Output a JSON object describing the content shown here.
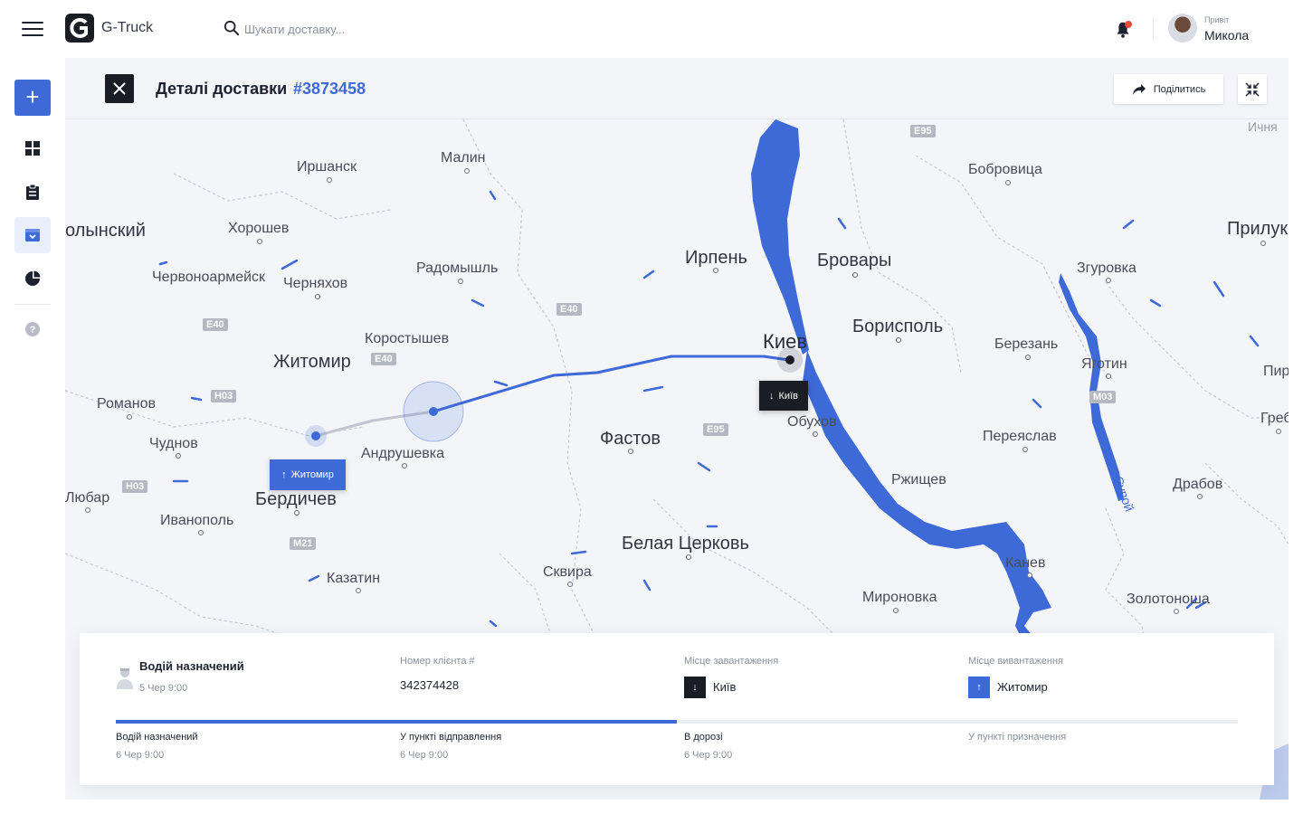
{
  "app": {
    "name": "G-Truck"
  },
  "search": {
    "placeholder": "Шукати доставку..."
  },
  "user": {
    "greeting": "Привіт",
    "name": "Микола"
  },
  "sidebar": {
    "items": [
      {
        "name": "dashboard",
        "icon": "grid-icon"
      },
      {
        "name": "clipboard",
        "icon": "clipboard-icon"
      },
      {
        "name": "deliveries",
        "icon": "box-icon",
        "active": true
      },
      {
        "name": "reports",
        "icon": "pie-chart-icon"
      },
      {
        "name": "help",
        "icon": "question-icon"
      }
    ]
  },
  "header": {
    "title": "Деталі доставки",
    "order_number": "#3873458",
    "share_label": "Поділитись"
  },
  "map": {
    "cities": [
      {
        "name": "Иршанск",
        "size": "normal"
      },
      {
        "name": "Малин",
        "size": "normal"
      },
      {
        "name": "Бобровица",
        "size": "normal"
      },
      {
        "name": "олынский",
        "size": "normal"
      },
      {
        "name": "Хорошев",
        "size": "normal"
      },
      {
        "name": "Прилук",
        "size": "normal"
      },
      {
        "name": "Радомышль",
        "size": "normal"
      },
      {
        "name": "Ирпень",
        "size": "normal"
      },
      {
        "name": "Бровары",
        "size": "big"
      },
      {
        "name": "Згуровка",
        "size": "normal"
      },
      {
        "name": "Червоноармейск",
        "size": "normal"
      },
      {
        "name": "Черняхов",
        "size": "normal"
      },
      {
        "name": "Киев",
        "size": "huge"
      },
      {
        "name": "Борисполь",
        "size": "big"
      },
      {
        "name": "Коростышев",
        "size": "normal"
      },
      {
        "name": "Житомир",
        "size": "big"
      },
      {
        "name": "Березань",
        "size": "normal"
      },
      {
        "name": "Яготин",
        "size": "normal"
      },
      {
        "name": "Пир",
        "size": "normal"
      },
      {
        "name": "Романов",
        "size": "normal"
      },
      {
        "name": "Обухов",
        "size": "normal"
      },
      {
        "name": "Гребе",
        "size": "normal"
      },
      {
        "name": "Чуднов",
        "size": "normal"
      },
      {
        "name": "Фастов",
        "size": "big"
      },
      {
        "name": "Переяслав",
        "size": "normal"
      },
      {
        "name": "Андрушевка",
        "size": "normal"
      },
      {
        "name": "Ржищев",
        "size": "normal"
      },
      {
        "name": "Драбов",
        "size": "normal"
      },
      {
        "name": "Любар",
        "size": "normal"
      },
      {
        "name": "Бердичев",
        "size": "big"
      },
      {
        "name": "Иванополь",
        "size": "normal"
      },
      {
        "name": "Белая Церковь",
        "size": "big"
      },
      {
        "name": "Канев",
        "size": "normal"
      },
      {
        "name": "Сквира",
        "size": "normal"
      },
      {
        "name": "Казатин",
        "size": "normal"
      },
      {
        "name": "Мироновка",
        "size": "normal"
      },
      {
        "name": "Золотоноша",
        "size": "normal"
      },
      {
        "name": "Ичня",
        "size": "normal"
      },
      {
        "name": "Супой",
        "size": "normal"
      }
    ],
    "roads": [
      "E95",
      "E40",
      "E40",
      "H03",
      "E40",
      "E95",
      "H03",
      "M21",
      "M03"
    ],
    "pins": {
      "loading": {
        "label": "Київ",
        "arrow": "↓"
      },
      "unloading": {
        "label": "Житомир",
        "arrow": "↑"
      }
    },
    "colors": {
      "route": "#3e6ad8",
      "water": "#3e6ad8",
      "background": "#f4f5f9"
    }
  },
  "info": {
    "driver_title": "Водій назначений",
    "driver_time": "5 Чер 9:00",
    "client_label": "Номер клієнта #",
    "client_value": "342374428",
    "loading_label": "Місце завантаження",
    "loading_value": "Київ",
    "loading_arrow": "↓",
    "unloading_label": "Місце вивантаження",
    "unloading_value": "Житомир",
    "unloading_arrow": "↑",
    "progress_fraction": 0.5,
    "steps": [
      {
        "label": "Водій назначений",
        "time": "6 Чер 9:00",
        "done": true
      },
      {
        "label": "У пункті відправлення",
        "time": "6 Чер 9:00",
        "done": true
      },
      {
        "label": "В дорозі",
        "time": "6 Чер 9:00",
        "done": true
      },
      {
        "label": "У пункті призначення",
        "time": "",
        "done": false
      }
    ]
  }
}
